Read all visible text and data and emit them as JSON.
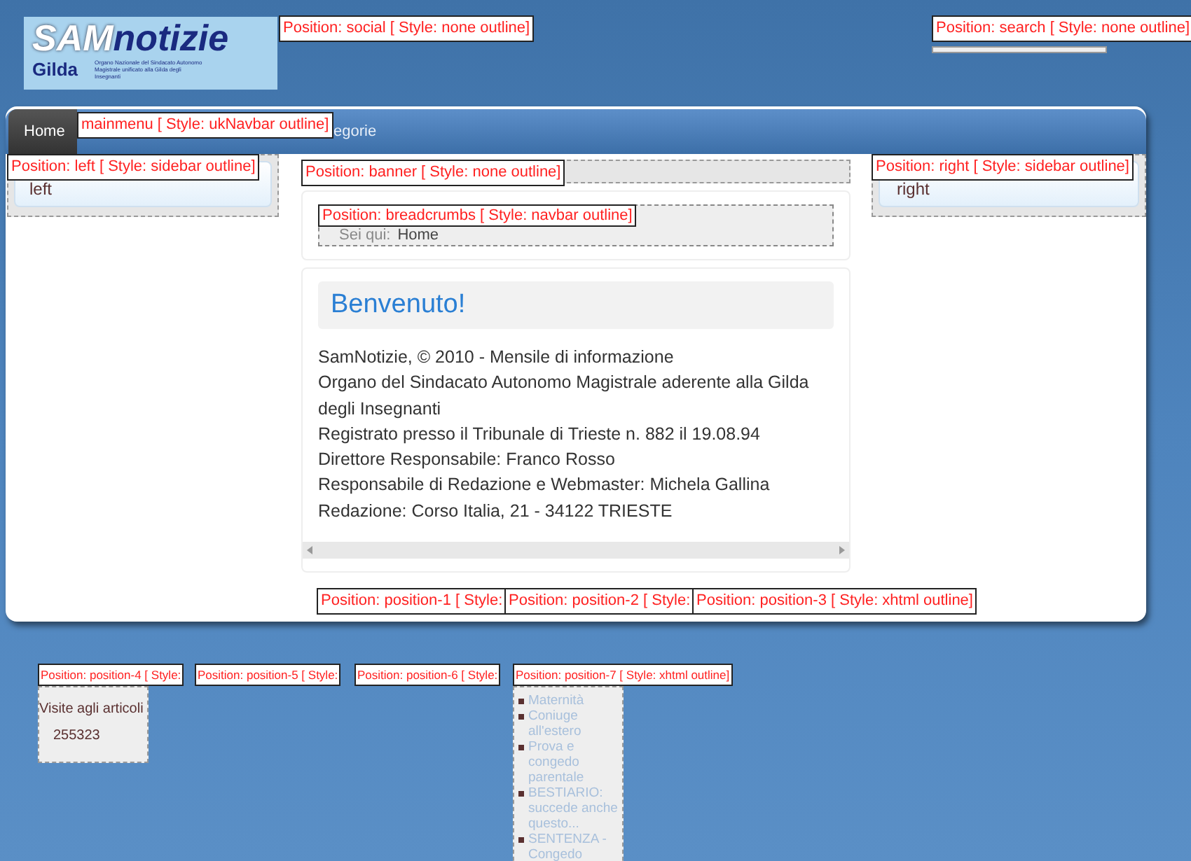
{
  "logo": {
    "title_1": "SAM",
    "title_2": "notizie",
    "subtitle": "Gilda",
    "tagline": "Organo Nazionale del Sindacato Autonomo Magistrale unificato alla Gilda degli Insegnanti"
  },
  "nav": {
    "items": [
      {
        "label": "Home",
        "selected": true
      },
      {
        "label": "egorie",
        "selected": false
      }
    ]
  },
  "left_module": {
    "text": "left"
  },
  "right_module": {
    "text": "right"
  },
  "breadcrumbs": {
    "prefix": "Sei qui:",
    "current": "Home"
  },
  "article": {
    "title": "Benvenuto!",
    "lines": [
      "SamNotizie, © 2010 - Mensile di informazione",
      "Organo del Sindacato Autonomo Magistrale aderente alla Gilda degli Insegnanti",
      "Registrato presso il Tribunale di Trieste n. 882 il 19.08.94",
      "Direttore Responsabile: Franco Rosso",
      "Responsabile di Redazione e Webmaster: Michela Gallina",
      "Redazione: Corso Italia, 21 - 34122 TRIESTE"
    ]
  },
  "visits": {
    "title": "Visite agli articoli",
    "count": "255323"
  },
  "articles_list": [
    "Maternità",
    "Coniuge all'estero",
    "Prova e congedo parentale",
    "BESTIARIO: succede anche questo...",
    "SENTENZA - Congedo"
  ],
  "position_labels": [
    "Position: social [ Style: none outline]",
    "Position: search [ Style: none outline]",
    "mainmenu [ Style: ukNavbar outline]",
    "Position: left [ Style: sidebar outline]",
    "Position: banner [ Style: none outline]",
    "Position: right [ Style: sidebar outline]",
    "Position: breadcrumbs [ Style: navbar outline]",
    "Position: position-1 [ Style:",
    "Position: position-2 [ Style:",
    "Position: position-3 [ Style: xhtml outline]",
    "Position: position-4 [ Style:",
    "Position: position-5 [ Style:",
    "Position: position-6 [ Style:",
    "Position: position-7 [ Style: xhtml outline]"
  ]
}
